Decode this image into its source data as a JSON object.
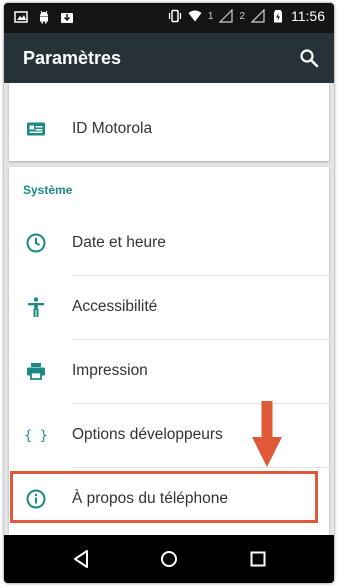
{
  "status_bar": {
    "time": "11:56",
    "sim1_label": "1",
    "sim2_label": "2",
    "left_icons": [
      "image-icon",
      "android-icon",
      "download-icon"
    ],
    "right_icons": [
      "vibrate-icon",
      "wifi-icon",
      "signal-icon",
      "signal-icon",
      "battery-icon"
    ]
  },
  "app_bar": {
    "title": "Paramètres",
    "search_icon": "search-icon"
  },
  "top_card": {
    "items": [
      {
        "label": "ID Motorola",
        "icon": "id-card-icon"
      }
    ]
  },
  "system_section": {
    "header": "Système",
    "items": [
      {
        "label": "Date et heure",
        "icon": "clock-icon"
      },
      {
        "label": "Accessibilité",
        "icon": "accessibility-icon"
      },
      {
        "label": "Impression",
        "icon": "printer-icon"
      },
      {
        "label": "Options développeurs",
        "icon": "braces-icon"
      },
      {
        "label": "À propos du téléphone",
        "icon": "info-icon",
        "highlighted": true
      }
    ]
  },
  "annotation": {
    "arrow_color": "#e05a3a",
    "highlight_color": "#e05a3a"
  },
  "nav_bar": {
    "buttons": [
      "back-icon",
      "home-icon",
      "recents-icon"
    ]
  },
  "colors": {
    "status_bar": "#141414",
    "app_bar": "#263238",
    "accent": "#1b8a83",
    "background": "#e4e4e4"
  }
}
